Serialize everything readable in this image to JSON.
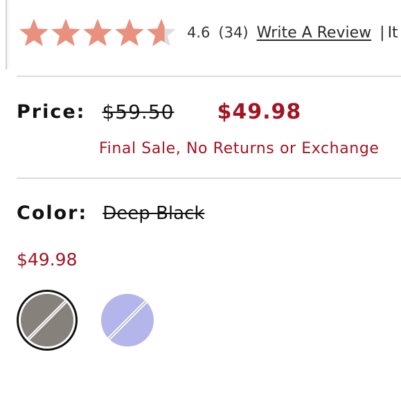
{
  "rating": {
    "stars_filled": 4.6,
    "stars_total": 5,
    "value": "4.6",
    "count": "(34)",
    "write_review": "Write A Review",
    "separator": "|",
    "truncated_text": "It",
    "star_color": "#e9917f",
    "star_empty_color": "#dedede"
  },
  "price": {
    "label": "Price:",
    "original": "$59.50",
    "sale": "$49.98",
    "note": "Final Sale, No Returns or Exchange"
  },
  "color": {
    "label": "Color:",
    "selected_name": "Deep Black",
    "price": "$49.98"
  },
  "swatches": [
    {
      "name": "Deep Black",
      "color": "#7d7771",
      "selected": true,
      "unavailable": true
    },
    {
      "name": "Lavender",
      "color": "#aeb0ea",
      "selected": false,
      "unavailable": true
    }
  ],
  "accent": "#a31423"
}
